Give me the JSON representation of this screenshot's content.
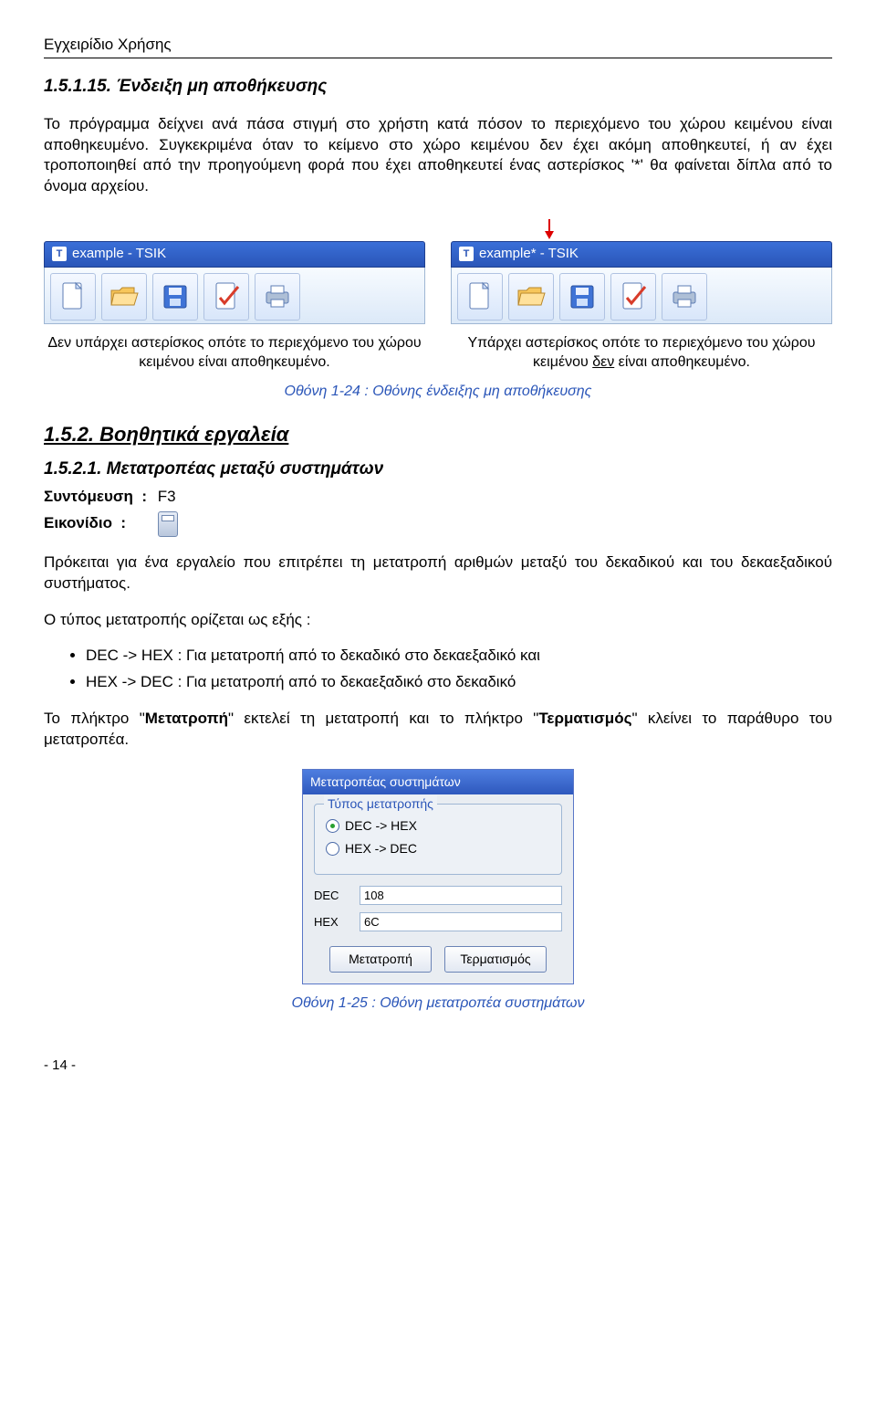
{
  "header": {
    "title": "Εγχειρίδιο Χρήσης"
  },
  "section_1515": {
    "heading": "1.5.1.15. Ένδειξη μη αποθήκευσης",
    "p1": "Το πρόγραμμα δείχνει ανά πάσα στιγμή στο χρήστη κατά πόσον το περιεχόμενο του χώρου κειμένου είναι αποθηκευμένο. Συγκεκριμένα όταν το κείμενο στο χώρο κειμένου δεν έχει ακόμη αποθηκευτεί, ή αν έχει τροποποιηθεί από την προηγούμενη φορά που έχει αποθηκευτεί ένας αστερίσκος '*' θα φαίνεται δίπλα από το όνομα αρχείου.",
    "titlebar_left": "example - TSIK",
    "titlebar_right": "example* - TSIK",
    "caption_left": "Δεν υπάρχει αστερίσκος οπότε το περιεχόμενο του χώρου κειμένου είναι αποθηκευμένο.",
    "caption_right_a": "Υπάρχει αστερίσκος οπότε το περιεχόμενο του χώρου κειμένου ",
    "caption_right_u": "δεν",
    "caption_right_b": " είναι αποθηκευμένο.",
    "fig_caption": "Οθόνη 1-24 : Οθόνης ένδειξης μη αποθήκευσης"
  },
  "section_152": {
    "heading": "1.5.2. Βοηθητικά εργαλεία"
  },
  "section_1521": {
    "heading": "1.5.2.1. Μετατροπέας μεταξύ συστημάτων",
    "shortcut_label": "Συντόμευση",
    "shortcut_value": "F3",
    "icon_label": "Εικονίδιο",
    "p1": "Πρόκειται για ένα εργαλείο που επιτρέπει τη μετατροπή αριθμών μεταξύ του δεκαδικού και του δεκαεξαδικού συστήματος.",
    "p2": "Ο τύπος μετατροπής ορίζεται ως εξής :",
    "bullet1": "DEC -> HEX : Για μετατροπή από το δεκαδικό στο δεκαεξαδικό και",
    "bullet2": "HEX -> DEC : Για μετατροπή από το δεκαεξαδικό στο δεκαδικό",
    "p3_a": "Το πλήκτρο \"",
    "p3_b": "Μετατροπή",
    "p3_c": "\" εκτελεί τη μετατροπή και το πλήκτρο \"",
    "p3_d": "Τερματισμός",
    "p3_e": "\" κλείνει το παράθυρο του μετατροπέα."
  },
  "converter": {
    "window_title": "Μετατροπέας συστημάτων",
    "group_label": "Τύπος μετατροπής",
    "opt1": "DEC -> HEX",
    "opt2": "HEX -> DEC",
    "dec_label": "DEC",
    "hex_label": "HEX",
    "dec_value": "108",
    "hex_value": "6C",
    "btn_convert": "Μετατροπή",
    "btn_close": "Τερματισμός",
    "fig_caption": "Οθόνη 1-25 : Οθόνη μετατροπέα συστημάτων"
  },
  "footer": {
    "page": "- 14 -"
  }
}
